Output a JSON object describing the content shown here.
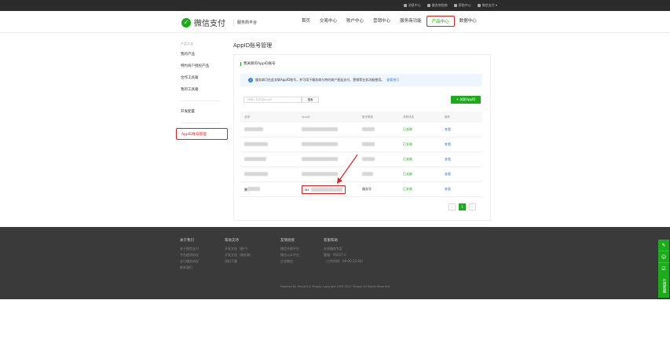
{
  "topbar": {
    "links": [
      {
        "icon": "message-icon",
        "label": "消息中心"
      },
      {
        "icon": "help-icon",
        "label": "服务商指南"
      },
      {
        "icon": "question-icon",
        "label": "帮助中心"
      },
      {
        "icon": "user-icon",
        "label": "微信支付 ▾"
      }
    ]
  },
  "header": {
    "logo_text": "微信支付",
    "sub_text": "服务商平台",
    "nav": [
      "首页",
      "交易中心",
      "账户中心",
      "营销中心",
      "服务商功能",
      "产品中心",
      "数据中心"
    ],
    "active_nav": "产品中心"
  },
  "sidebar": {
    "group_label": "产品大全",
    "items": [
      "我的产品",
      "特约商户授权产品",
      "合作工具箱",
      "我的工具箱"
    ],
    "dev_label": "开发配置",
    "active_item": "AppID账号管理"
  },
  "main": {
    "title": "AppID账号管理",
    "card_title": "我关联的AppID账号",
    "notice_text": "服务商可在此关联AppID账号，并可用于服务商与特约商户直连支付、营销等业务功能使用。",
    "notice_link": "查看指引",
    "search_placeholder": "请输入名称或AppID",
    "search_button": "搜索",
    "add_button": "+ 关联AppID",
    "columns": [
      "名称",
      "AppID",
      "账号类型",
      "关联状态",
      "操作"
    ],
    "rows": [
      {
        "name": "",
        "appid": "",
        "type": "",
        "status": "已关联",
        "op": "查看"
      },
      {
        "name": "",
        "appid": "",
        "type": "",
        "status": "已关联",
        "op": "查看"
      },
      {
        "name": "",
        "appid": "",
        "type": "",
        "status": "已关联",
        "op": "查看"
      },
      {
        "name": "",
        "appid": "",
        "type": "",
        "status": "已关联",
        "op": "查看"
      },
      {
        "name": "腾",
        "appid": "wx",
        "type": "服务号",
        "status": "已关联",
        "op": "查看"
      }
    ],
    "pager": {
      "prev": "‹",
      "current": "1",
      "next": "›"
    }
  },
  "footer": {
    "cols": [
      {
        "head": "关于我们",
        "items": [
          "关于微信支付",
          "平台使用协议",
          "支付服务协议",
          "联系我们"
        ]
      },
      {
        "head": "帮助支持",
        "items": [
          "开发文档（普户）",
          "开发文档（服务商）",
          "资料下载"
        ]
      },
      {
        "head": "友情链接",
        "items": [
          "微信开放平台",
          "微信公众平台",
          "企业微信"
        ]
      },
      {
        "head": "客服帮助",
        "items": [
          "在线服务专区",
          "客服：95017-1",
          "（工作时间：09:00-22:00）"
        ]
      }
    ],
    "copyright": "Powered By Tencent & Tenpay   Copyright 2005-2017 Tenpay All Rights Reserved"
  },
  "float_bar": {
    "icons": [
      "edit-icon",
      "chat-icon",
      "checklist-icon"
    ],
    "label": "在线客服"
  },
  "colors": {
    "brand": "#1aad19",
    "highlight": "#e02020",
    "link": "#3b7de0"
  }
}
